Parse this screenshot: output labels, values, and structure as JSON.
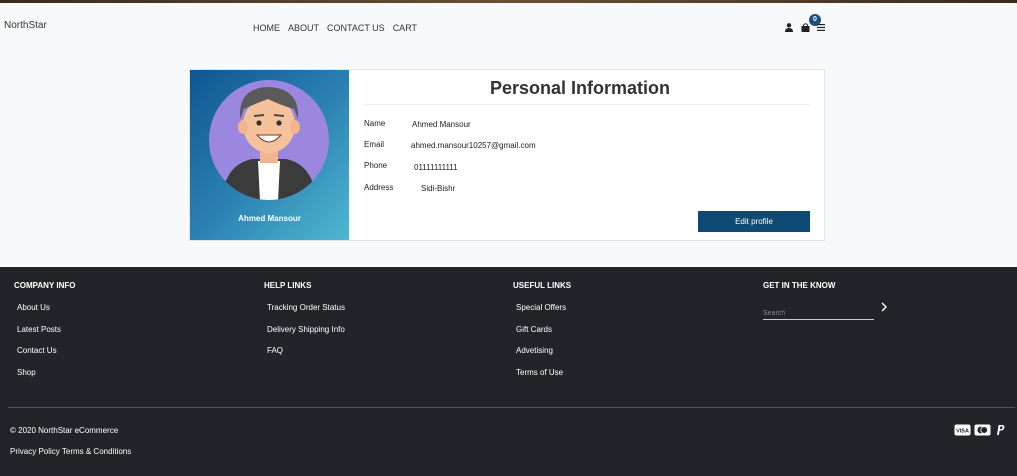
{
  "header": {
    "brand": "NorthStar",
    "nav": [
      "HOME",
      "ABOUT",
      "CONTACT US",
      "CART"
    ],
    "cart_count": "0"
  },
  "profile": {
    "name": "Ahmed Mansour",
    "title": "Personal Information",
    "fields": [
      {
        "label": "Name",
        "value": "Ahmed Mansour"
      },
      {
        "label": "Email",
        "value": "ahmed.mansour10257@gmail.com"
      },
      {
        "label": "Phone",
        "value": "01111111111"
      },
      {
        "label": "Address",
        "value": "Sidi-Bishr"
      }
    ],
    "edit_label": "Edit profile"
  },
  "footer": {
    "company": {
      "title": "COMPANY INFO",
      "links": [
        "About Us",
        "Latest Posts",
        "Contact Us",
        "Shop"
      ]
    },
    "help": {
      "title": "HELP LINKS",
      "links": [
        "Tracking Order Status",
        "Delivery Shipping Info",
        "FAQ"
      ]
    },
    "useful": {
      "title": "USEFUL LINKS",
      "links": [
        "Special Offers",
        "Gift Cards",
        "Advetising",
        "Terms of Use"
      ]
    },
    "know": {
      "title": "GET IN THE KNOW",
      "search_placeholder": "Search"
    },
    "copyright": "© 2020 NorthStar eCommerce",
    "privacy": "Privacy Policy",
    "terms": "Terms & Conditions",
    "payment_icons": [
      "visa-icon",
      "mastercard-icon",
      "paypal-icon"
    ]
  },
  "colors": {
    "accent": "#0e4a74",
    "footer_bg": "#212529",
    "avatar_circle": "#9b87e0"
  }
}
